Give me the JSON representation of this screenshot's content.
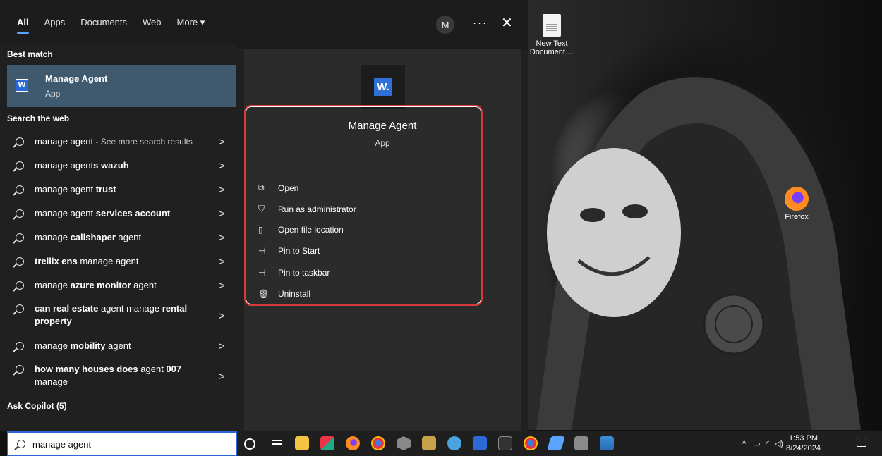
{
  "top_tabs": [
    {
      "label": "All",
      "active": true
    },
    {
      "label": "Apps"
    },
    {
      "label": "Documents"
    },
    {
      "label": "Web"
    },
    {
      "label": "More ▾"
    }
  ],
  "account_initial": "M",
  "more_options_glyph": "···",
  "close_glyph": "✕",
  "best_match": {
    "section_label": "Best match",
    "name": "Manage Agent",
    "type": "App",
    "icon_letter": "W"
  },
  "search_web": {
    "section_label": "Search the web",
    "items": [
      {
        "pre": "manage agent",
        "bold": "",
        "post": "",
        "hint": " - See more search results"
      },
      {
        "pre": "manage agent",
        "bold": "s wazuh",
        "post": "",
        "hint": ""
      },
      {
        "pre": "manage agent ",
        "bold": "trust",
        "post": "",
        "hint": ""
      },
      {
        "pre": "manage agent ",
        "bold": "services account",
        "post": "",
        "hint": ""
      },
      {
        "pre": "manage ",
        "bold": "callshaper",
        "post": " agent",
        "hint": ""
      },
      {
        "pre": "",
        "bold": "trellix ens",
        "post": " manage agent",
        "hint": ""
      },
      {
        "pre": "manage ",
        "bold": "azure monitor",
        "post": " agent",
        "hint": ""
      },
      {
        "pre": "",
        "bold": "can real estate",
        "post": " agent manage ",
        "bold2": "rental property",
        "hint": ""
      },
      {
        "pre": "manage ",
        "bold": "mobility",
        "post": " agent",
        "hint": ""
      },
      {
        "pre": "",
        "bold": "how many houses does",
        "post": " agent ",
        "bold2": "007",
        "post2": " manage",
        "hint": ""
      }
    ]
  },
  "ask_copilot": "Ask Copilot (5)",
  "detail": {
    "icon_letter": "W.",
    "name": "Manage Agent",
    "type": "App",
    "actions": [
      {
        "icon": "open-icon",
        "glyph": "⧉",
        "label": "Open"
      },
      {
        "icon": "shield-admin-icon",
        "glyph": "⛉",
        "label": "Run as administrator"
      },
      {
        "icon": "folder-location-icon",
        "glyph": "▯",
        "label": "Open file location"
      },
      {
        "icon": "pin-icon",
        "glyph": "⊣",
        "label": "Pin to Start"
      },
      {
        "icon": "pin-icon",
        "glyph": "⊣",
        "label": "Pin to taskbar"
      },
      {
        "icon": "trash-icon",
        "glyph": "🗑",
        "label": "Uninstall"
      }
    ]
  },
  "search_box": {
    "value": "manage agent"
  },
  "desktop_icons": [
    {
      "label": "New Text Document...."
    },
    {
      "label": "Firefox"
    }
  ],
  "taskbar": {
    "tray_chevron": "^",
    "time": "1:53 PM",
    "date": "8/24/2024"
  },
  "colors": {
    "panel": "#202020",
    "highlight": "#3f5a6f",
    "accent": "#2b6ad6",
    "outline": "#d73a3a"
  }
}
